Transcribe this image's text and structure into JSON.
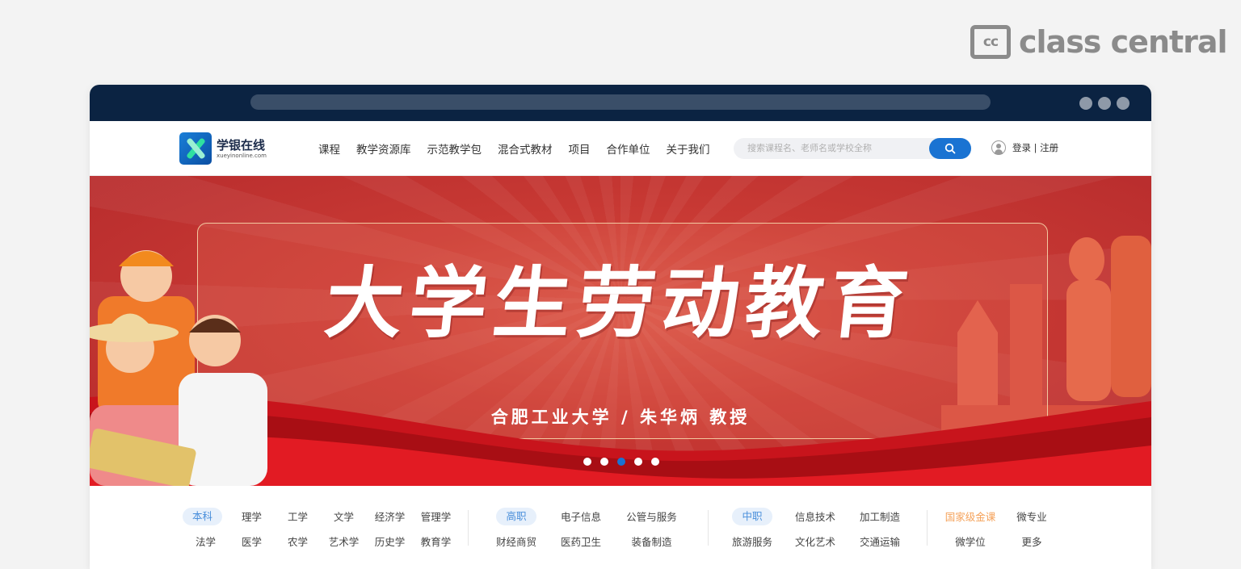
{
  "watermark": {
    "badge": "cc",
    "text": "class central"
  },
  "site": {
    "name": "学银在线",
    "url": "xueyinonline.com"
  },
  "nav": [
    "课程",
    "教学资源库",
    "示范教学包",
    "混合式教材",
    "项目",
    "合作单位",
    "关于我们"
  ],
  "search": {
    "placeholder": "搜索课程名、老师名或学校全称"
  },
  "user": {
    "login_register": "登录 | 注册"
  },
  "banner": {
    "title": "大学生劳动教育",
    "subtitle": "合肥工业大学 / 朱华炳 教授",
    "slide_count": 5,
    "active_slide": 3
  },
  "categories": {
    "benke": {
      "tag": "本科",
      "items": [
        "理学",
        "工学",
        "文学",
        "经济学",
        "管理学",
        "法学",
        "医学",
        "农学",
        "艺术学",
        "历史学",
        "教育学"
      ]
    },
    "gaozhi": {
      "tag": "高职",
      "items": [
        "电子信息",
        "公管与服务",
        "财经商贸",
        "医药卫生",
        "装备制造"
      ]
    },
    "zhongzhi": {
      "tag": "中职",
      "items": [
        "信息技术",
        "加工制造",
        "旅游服务",
        "文化艺术",
        "交通运输"
      ]
    },
    "special": {
      "items": [
        "国家级金课",
        "微专业",
        "微学位",
        "更多"
      ]
    }
  },
  "colors": {
    "nav_dark": "#0b2342",
    "accent_blue": "#1a73d2",
    "banner_red": "#c93a34",
    "gold_course": "#f5a25a"
  }
}
